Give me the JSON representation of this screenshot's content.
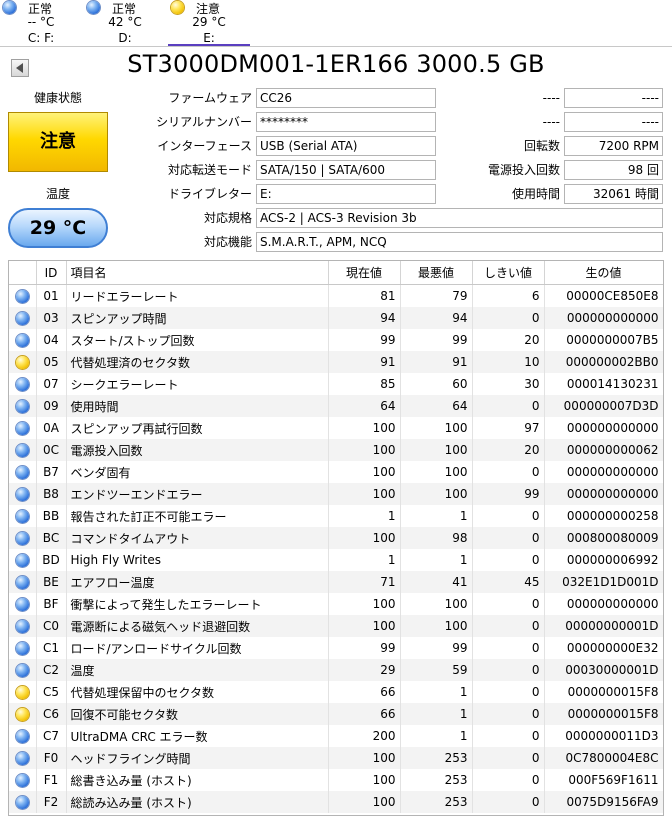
{
  "drives": [
    {
      "status": "正常",
      "temperature": "-- °C",
      "letter": "C: F:",
      "status_color": "blue"
    },
    {
      "status": "正常",
      "temperature": "42 °C",
      "letter": "D:",
      "status_color": "blue"
    },
    {
      "status": "注意",
      "temperature": "29 °C",
      "letter": "E:",
      "status_color": "yellow"
    }
  ],
  "disk_title": "ST3000DM001-1ER166 3000.5 GB",
  "health": {
    "label": "健康状態",
    "value": "注意",
    "color": "#ffd800"
  },
  "temperature": {
    "label": "温度",
    "value": "29 °C",
    "color": "#6aa9ee"
  },
  "info": {
    "firmware": {
      "label": "ファームウェア",
      "value": "CC26"
    },
    "serial": {
      "label": "シリアルナンバー",
      "value": "********"
    },
    "interface": {
      "label": "インターフェース",
      "value": "USB (Serial ATA)"
    },
    "transfer_mode": {
      "label": "対応転送モード",
      "value": "SATA/150 | SATA/600"
    },
    "drive_letter": {
      "label": "ドライブレター",
      "value": "E:"
    },
    "standard": {
      "label": "対応規格",
      "value": "ACS-2 | ACS-3 Revision 3b"
    },
    "features": {
      "label": "対応機能",
      "value": "S.M.A.R.T., APM, NCQ"
    },
    "blank1": {
      "label": "----",
      "value": "----"
    },
    "blank2": {
      "label": "----",
      "value": "----"
    },
    "rotation": {
      "label": "回転数",
      "value": "7200 RPM"
    },
    "power_on_count": {
      "label": "電源投入回数",
      "value": "98 回"
    },
    "power_on_hours": {
      "label": "使用時間",
      "value": "32061 時間"
    }
  },
  "smart": {
    "headers": [
      "ID",
      "項目名",
      "現在値",
      "最悪値",
      "しきい値",
      "生の値"
    ],
    "rows": [
      {
        "status": "blue",
        "id": "01",
        "name": "リードエラーレート",
        "current": "81",
        "worst": "79",
        "threshold": "6",
        "raw": "00000CE850E8"
      },
      {
        "status": "blue",
        "id": "03",
        "name": "スピンアップ時間",
        "current": "94",
        "worst": "94",
        "threshold": "0",
        "raw": "000000000000"
      },
      {
        "status": "blue",
        "id": "04",
        "name": "スタート/ストップ回数",
        "current": "99",
        "worst": "99",
        "threshold": "20",
        "raw": "0000000007B5"
      },
      {
        "status": "yellow",
        "id": "05",
        "name": "代替処理済のセクタ数",
        "current": "91",
        "worst": "91",
        "threshold": "10",
        "raw": "000000002BB0"
      },
      {
        "status": "blue",
        "id": "07",
        "name": "シークエラーレート",
        "current": "85",
        "worst": "60",
        "threshold": "30",
        "raw": "000014130231"
      },
      {
        "status": "blue",
        "id": "09",
        "name": "使用時間",
        "current": "64",
        "worst": "64",
        "threshold": "0",
        "raw": "000000007D3D"
      },
      {
        "status": "blue",
        "id": "0A",
        "name": "スピンアップ再試行回数",
        "current": "100",
        "worst": "100",
        "threshold": "97",
        "raw": "000000000000"
      },
      {
        "status": "blue",
        "id": "0C",
        "name": "電源投入回数",
        "current": "100",
        "worst": "100",
        "threshold": "20",
        "raw": "000000000062"
      },
      {
        "status": "blue",
        "id": "B7",
        "name": "ベンダ固有",
        "current": "100",
        "worst": "100",
        "threshold": "0",
        "raw": "000000000000"
      },
      {
        "status": "blue",
        "id": "B8",
        "name": "エンドツーエンドエラー",
        "current": "100",
        "worst": "100",
        "threshold": "99",
        "raw": "000000000000"
      },
      {
        "status": "blue",
        "id": "BB",
        "name": "報告された訂正不可能エラー",
        "current": "1",
        "worst": "1",
        "threshold": "0",
        "raw": "000000000258"
      },
      {
        "status": "blue",
        "id": "BC",
        "name": "コマンドタイムアウト",
        "current": "100",
        "worst": "98",
        "threshold": "0",
        "raw": "000800080009"
      },
      {
        "status": "blue",
        "id": "BD",
        "name": "High Fly Writes",
        "current": "1",
        "worst": "1",
        "threshold": "0",
        "raw": "000000006992"
      },
      {
        "status": "blue",
        "id": "BE",
        "name": "エアフロー温度",
        "current": "71",
        "worst": "41",
        "threshold": "45",
        "raw": "032E1D1D001D"
      },
      {
        "status": "blue",
        "id": "BF",
        "name": "衝撃によって発生したエラーレート",
        "current": "100",
        "worst": "100",
        "threshold": "0",
        "raw": "000000000000"
      },
      {
        "status": "blue",
        "id": "C0",
        "name": "電源断による磁気ヘッド退避回数",
        "current": "100",
        "worst": "100",
        "threshold": "0",
        "raw": "00000000001D"
      },
      {
        "status": "blue",
        "id": "C1",
        "name": "ロード/アンロードサイクル回数",
        "current": "99",
        "worst": "99",
        "threshold": "0",
        "raw": "000000000E32"
      },
      {
        "status": "blue",
        "id": "C2",
        "name": "温度",
        "current": "29",
        "worst": "59",
        "threshold": "0",
        "raw": "00030000001D"
      },
      {
        "status": "yellow",
        "id": "C5",
        "name": "代替処理保留中のセクタ数",
        "current": "66",
        "worst": "1",
        "threshold": "0",
        "raw": "0000000015F8"
      },
      {
        "status": "yellow",
        "id": "C6",
        "name": "回復不可能セクタ数",
        "current": "66",
        "worst": "1",
        "threshold": "0",
        "raw": "0000000015F8"
      },
      {
        "status": "blue",
        "id": "C7",
        "name": "UltraDMA CRC エラー数",
        "current": "200",
        "worst": "1",
        "threshold": "0",
        "raw": "0000000011D3"
      },
      {
        "status": "blue",
        "id": "F0",
        "name": "ヘッドフライング時間",
        "current": "100",
        "worst": "253",
        "threshold": "0",
        "raw": "0C7800004E8C"
      },
      {
        "status": "blue",
        "id": "F1",
        "name": "総書き込み量 (ホスト)",
        "current": "100",
        "worst": "253",
        "threshold": "0",
        "raw": "000F569F1611"
      },
      {
        "status": "blue",
        "id": "F2",
        "name": "総読み込み量 (ホスト)",
        "current": "100",
        "worst": "253",
        "threshold": "0",
        "raw": "0075D9156FA9"
      }
    ]
  }
}
